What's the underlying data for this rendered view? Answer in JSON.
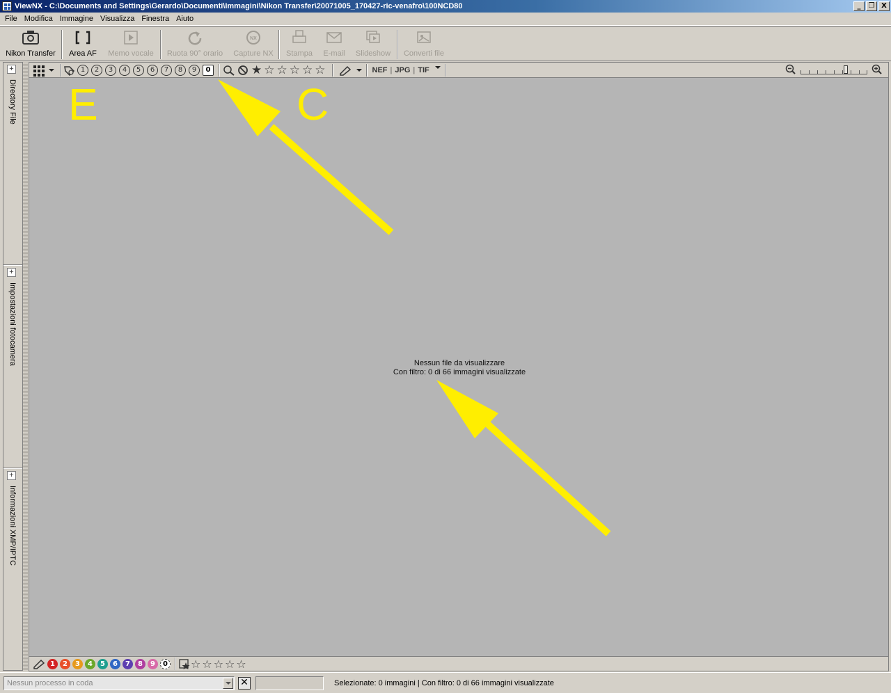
{
  "window": {
    "title": "ViewNX - C:\\Documents and Settings\\Gerardo\\Documenti\\Immagini\\Nikon Transfer\\20071005_170427-ric-venafro\\100NCD80",
    "controls": [
      "_",
      "❐",
      "X"
    ]
  },
  "menu": [
    "File",
    "Modifica",
    "Immagine",
    "Visualizza",
    "Finestra",
    "Aiuto"
  ],
  "toolbar": {
    "nikon_transfer": "Nikon Transfer",
    "area_af": "Area AF",
    "memo_vocale": "Memo vocale",
    "ruota": "Ruota 90° orario",
    "capture_nx": "Capture NX",
    "stampa": "Stampa",
    "email": "E-mail",
    "slideshow": "Slideshow",
    "converti": "Converti file"
  },
  "left_panels": {
    "directory": "Directory File",
    "impostazioni": "Impostazioni fotocamera",
    "informazioni": "Informazioni XMP/IPTC",
    "expand": "+"
  },
  "filter": {
    "label_numbers": [
      "1",
      "2",
      "3",
      "4",
      "5",
      "6",
      "7",
      "8",
      "9",
      "0"
    ],
    "stars": [
      "★",
      "☆",
      "☆",
      "☆",
      "☆",
      "☆"
    ],
    "formats": [
      "NEF",
      "JPG",
      "TIF"
    ]
  },
  "viewer": {
    "empty_line1": "Nessun file da visualizzare",
    "empty_line2": "Con filtro: 0 di 66 immagini visualizzate",
    "overlay_letter_e": "E",
    "overlay_letter_c": "C",
    "annotation_color": "#ffee00"
  },
  "label_bar": {
    "labels": [
      {
        "num": "1",
        "color": "#d32424"
      },
      {
        "num": "2",
        "color": "#e8502a"
      },
      {
        "num": "3",
        "color": "#e79a1b"
      },
      {
        "num": "4",
        "color": "#6aa82b"
      },
      {
        "num": "5",
        "color": "#1f9f8f"
      },
      {
        "num": "6",
        "color": "#2f67c4"
      },
      {
        "num": "7",
        "color": "#5d3fb0"
      },
      {
        "num": "8",
        "color": "#b03fa0"
      },
      {
        "num": "9",
        "color": "#d86aa8"
      },
      {
        "num": "0",
        "color": "#ffffff"
      }
    ],
    "rating_stars": [
      "☆",
      "☆",
      "☆",
      "☆",
      "☆"
    ]
  },
  "status": {
    "queue_placeholder": "Nessun processo in coda",
    "cancel": "✕",
    "text": "Selezionate: 0 immagini | Con filtro: 0 di 66 immagini visualizzate"
  }
}
